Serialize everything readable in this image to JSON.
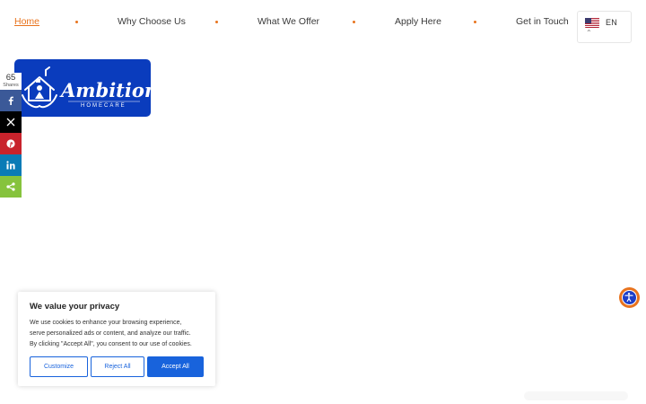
{
  "nav": {
    "items": [
      {
        "label": "Home",
        "active": true
      },
      {
        "label": "Why Choose Us",
        "active": false
      },
      {
        "label": "What We Offer",
        "active": false
      },
      {
        "label": "Apply Here",
        "active": false
      },
      {
        "label": "Get in Touch",
        "active": false
      }
    ],
    "language": {
      "code": "EN",
      "flag_icon": "us-flag-icon",
      "caret_icon": "chevron-up-icon"
    }
  },
  "logo": {
    "wordmark": "Ambition",
    "tagline": "HOMECARE",
    "background": "#0a3cbd"
  },
  "share": {
    "count": "65",
    "count_label": "Shares",
    "buttons": [
      {
        "network": "facebook",
        "icon": "facebook-icon",
        "color": "#3b5998"
      },
      {
        "network": "x",
        "icon": "x-icon",
        "color": "#000000"
      },
      {
        "network": "pinterest",
        "icon": "pinterest-icon",
        "color": "#c8232c"
      },
      {
        "network": "linkedin",
        "icon": "linkedin-icon",
        "color": "#0a7bb6"
      },
      {
        "network": "sharethis",
        "icon": "share-icon",
        "color": "#86c33d"
      }
    ]
  },
  "accessibility": {
    "icon": "accessibility-icon"
  },
  "cookie": {
    "title": "We value your privacy",
    "lines": [
      "We use cookies to enhance your browsing experience,",
      "serve personalized ads or content, and analyze our traffic.",
      "By clicking \"Accept All\", you consent to our use of cookies."
    ],
    "customize": "Customize",
    "reject": "Reject All",
    "accept": "Accept All"
  },
  "colors": {
    "accent": "#e8731e",
    "primary": "#1863dc"
  }
}
